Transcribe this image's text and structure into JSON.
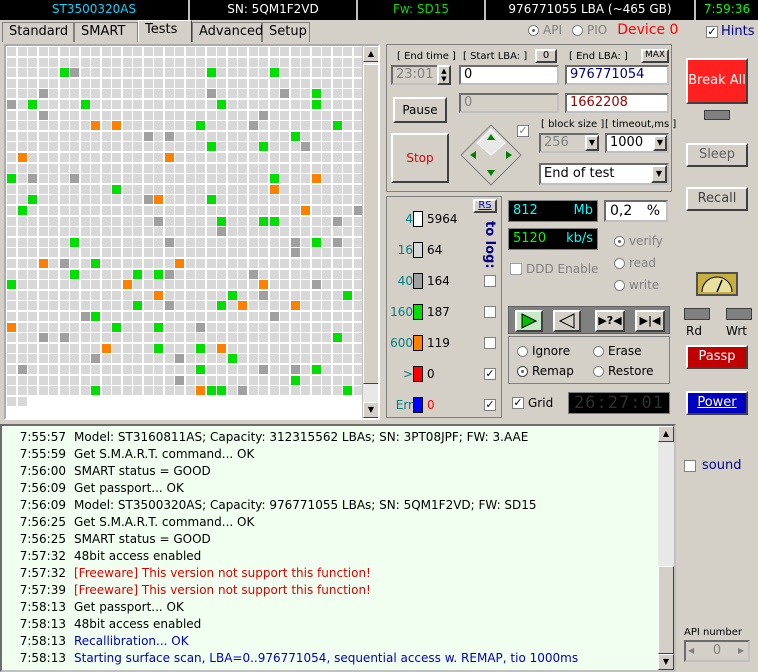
{
  "topbar": {
    "model": "ST3500320AS",
    "serial": "SN: 5QM1F2VD",
    "firmware": "Fw: SD15",
    "lba": "976771055 LBA (~465 GB)",
    "clock": "7:59:36"
  },
  "tabs": [
    {
      "label": "Standard"
    },
    {
      "label": "SMART"
    },
    {
      "label": "Tests"
    },
    {
      "label": "Advanced"
    },
    {
      "label": "Setup"
    }
  ],
  "modes": {
    "api": "API",
    "pio": "PIO",
    "device": "Device 0",
    "hints": "Hints"
  },
  "controls": {
    "end_time_label": "[ End time ]",
    "end_time_value": "23:01",
    "start_lba_label": "[ Start LBA: ]",
    "start_lba_btn": "0",
    "start_lba_value": "0",
    "end_lba_label": "[ End LBA: ]",
    "end_lba_btn": "MAX",
    "end_lba_value": "976771054",
    "current_value": "0",
    "current_lba": "1662208",
    "pause_label": "Pause",
    "stop_label": "Stop",
    "block_size_label": "[ block size ]",
    "block_size_value": "256",
    "timeout_label": "[ timeout,ms ]",
    "timeout_value": "1000",
    "end_action": "End of test"
  },
  "timing": {
    "rs_label": "RS",
    "to_log_label": "to log:",
    "rows": [
      {
        "ms": "4",
        "count": "5964",
        "color": "#ffffff"
      },
      {
        "ms": "16",
        "count": "64",
        "color": "#d8d8d8"
      },
      {
        "ms": "40",
        "count": "164",
        "color": "#a0a0a0"
      },
      {
        "ms": "160",
        "count": "187",
        "color": "#00e000"
      },
      {
        "ms": "600",
        "count": "119",
        "color": "#ff8000"
      },
      {
        "ms": ">",
        "count": "0",
        "color": "#ff0000"
      },
      {
        "ms": "Err",
        "count": "0",
        "color": "#0000ff"
      }
    ]
  },
  "stats": {
    "mb_value": "812",
    "mb_unit": "Mb",
    "percent_value": "0,2",
    "percent_unit": "%",
    "speed_value": "5120",
    "speed_unit": "kb/s",
    "ddd_enable": "DDD Enable",
    "verify": "verify",
    "read": "read",
    "write": "write",
    "ignore": "Ignore",
    "erase": "Erase",
    "remap": "Remap",
    "restore": "Restore",
    "grid": "Grid",
    "timer": "26:27:01"
  },
  "sidebar": {
    "break_all": "Break All",
    "sleep": "Sleep",
    "recall": "Recall",
    "rd": "Rd",
    "wrt": "Wrt",
    "passp": "Passp",
    "power": "Power",
    "sound": "sound",
    "api_number_label": "API number",
    "api_number_value": "0"
  },
  "log": [
    {
      "time": "7:55:57",
      "msg": "Model: ST3160811AS; Capacity: 312315562 LBAs; SN: 3PT08JPF; FW: 3.AAE",
      "kind": "normal"
    },
    {
      "time": "7:55:59",
      "msg": "Get S.M.A.R.T. command... OK",
      "kind": "normal"
    },
    {
      "time": "7:56:00",
      "msg": "SMART status = GOOD",
      "kind": "normal"
    },
    {
      "time": "7:56:09",
      "msg": "Get passport... OK",
      "kind": "normal"
    },
    {
      "time": "7:56:09",
      "msg": "Model: ST3500320AS; Capacity: 976771055 LBAs; SN: 5QM1F2VD; FW: SD15",
      "kind": "normal"
    },
    {
      "time": "7:56:25",
      "msg": "Get S.M.A.R.T. command... OK",
      "kind": "normal"
    },
    {
      "time": "7:56:25",
      "msg": "SMART status = GOOD",
      "kind": "normal"
    },
    {
      "time": "7:57:32",
      "msg": "48bit access enabled",
      "kind": "normal"
    },
    {
      "time": "7:57:32",
      "msg": "[Freeware] This version not support this function!",
      "kind": "warn"
    },
    {
      "time": "7:57:39",
      "msg": "[Freeware] This version not support this function!",
      "kind": "warn"
    },
    {
      "time": "7:58:13",
      "msg": "Get passport... OK",
      "kind": "normal"
    },
    {
      "time": "7:58:13",
      "msg": "48bit access enabled",
      "kind": "normal"
    },
    {
      "time": "7:58:13",
      "msg": "Recallibration... OK",
      "kind": "info"
    },
    {
      "time": "7:58:13",
      "msg": "Starting surface scan, LBA=0..976771054, sequential access w. REMAP, tio 1000ms",
      "kind": "info"
    }
  ],
  "colors": {
    "gray_light": "#d8d8d8",
    "gray_dark": "#a0a0a0",
    "green": "#00e000",
    "orange": "#ff8000"
  }
}
